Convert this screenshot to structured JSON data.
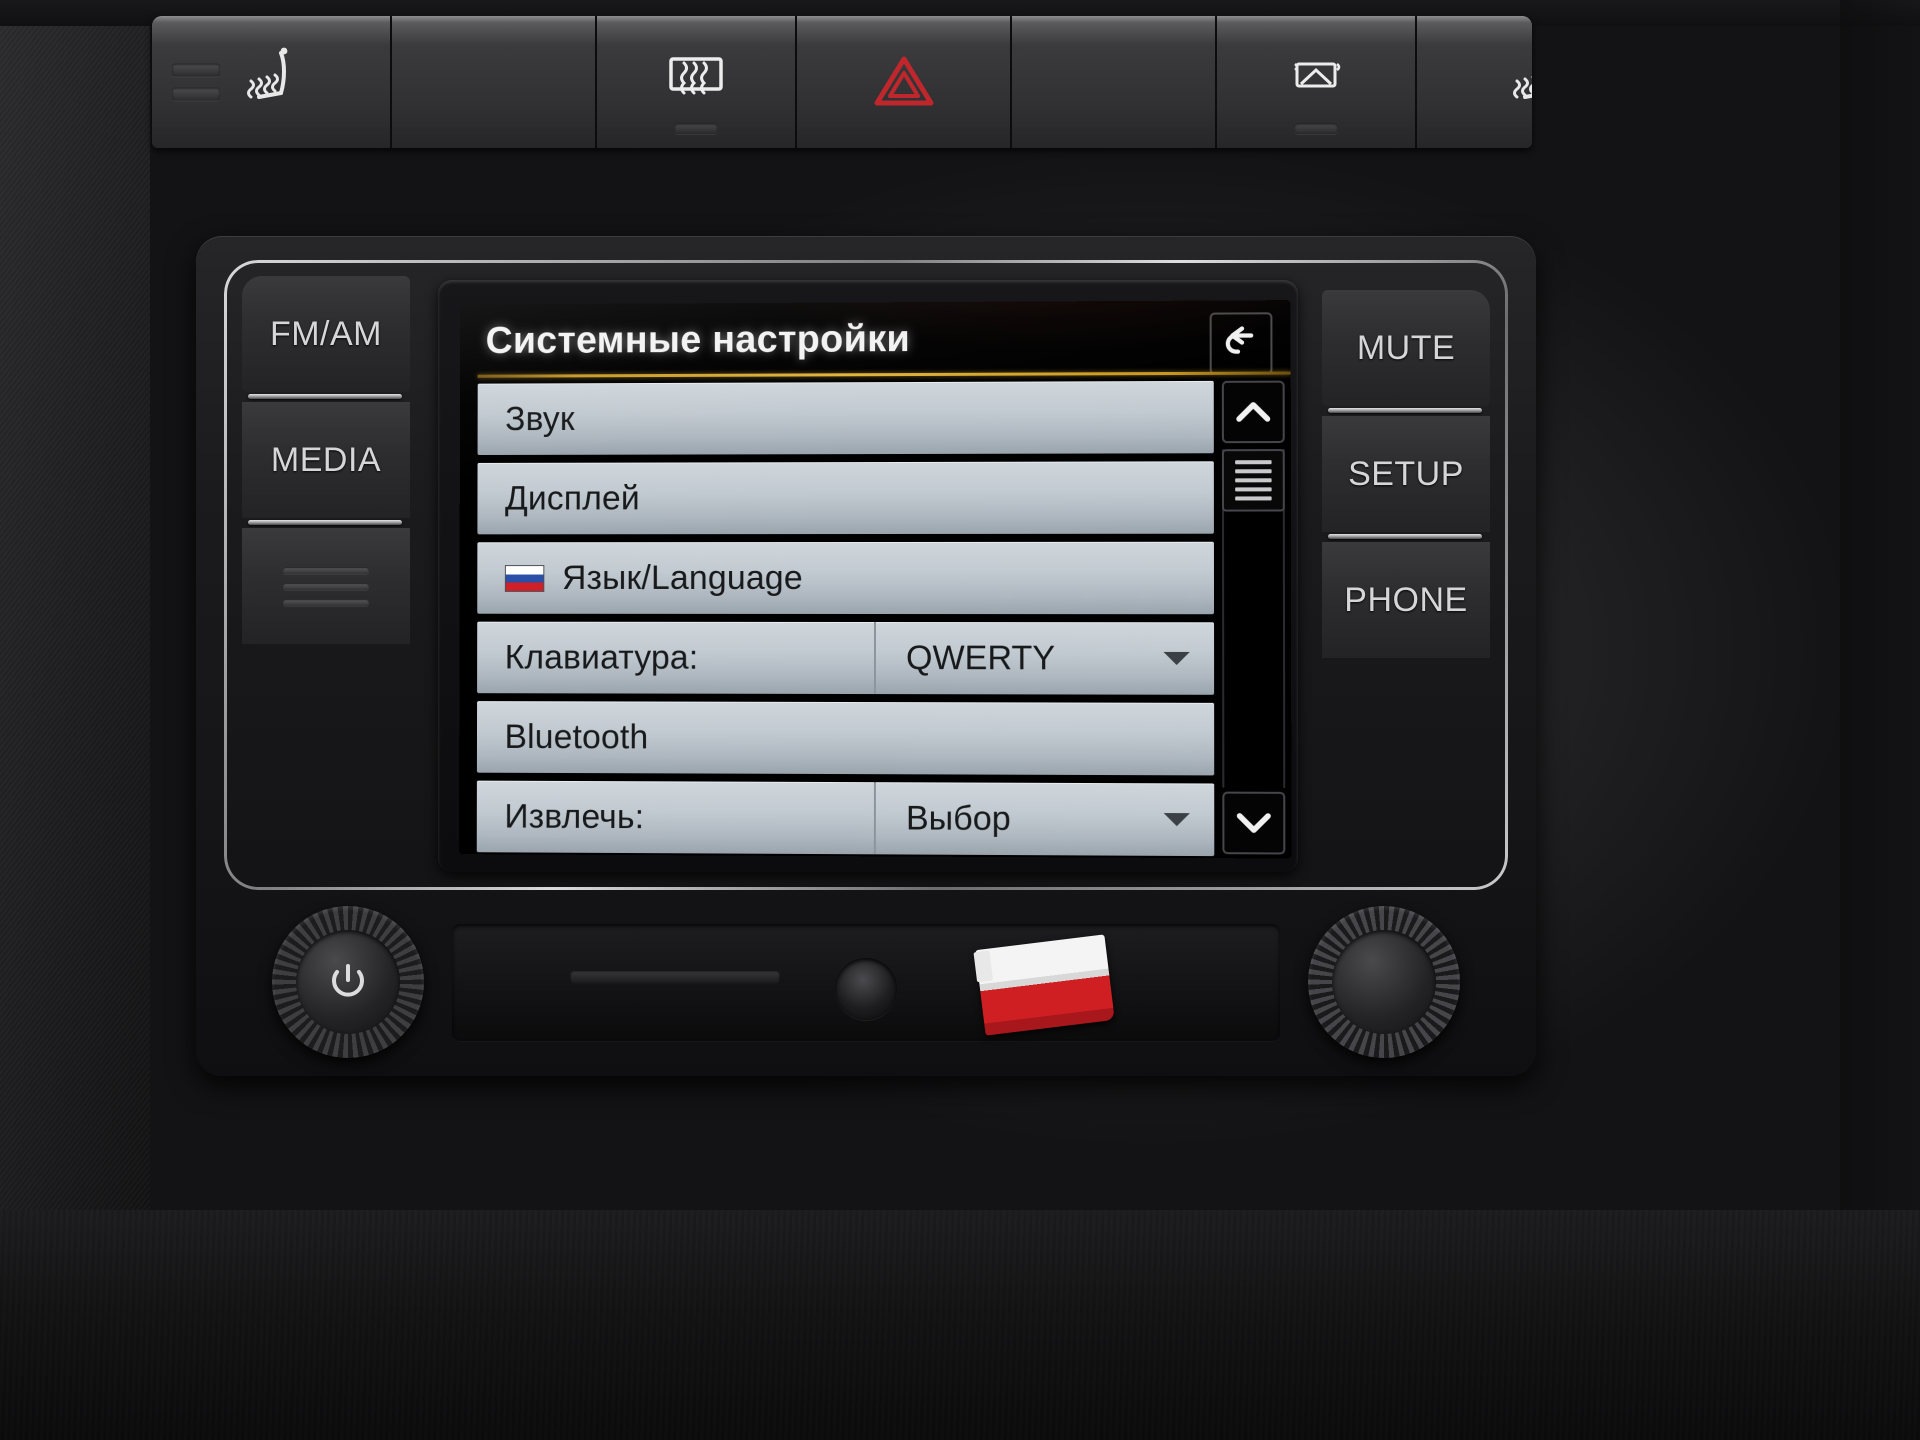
{
  "climate_strip": {
    "buttons": [
      {
        "name": "seat-heater-left",
        "icon": "heated-seat-icon",
        "has_led": false,
        "has_ribs": true
      },
      {
        "name": "climate-blank-1",
        "icon": "",
        "has_led": false,
        "has_ribs": false
      },
      {
        "name": "rear-window-defrost",
        "icon": "rear-defrost-icon",
        "has_led": true,
        "has_ribs": false
      },
      {
        "name": "hazard-warning",
        "icon": "hazard-triangle-icon",
        "has_led": false,
        "has_ribs": false
      },
      {
        "name": "climate-blank-2",
        "icon": "",
        "has_led": false,
        "has_ribs": false
      },
      {
        "name": "rear-wiper-washer",
        "icon": "rear-washer-icon",
        "has_led": true,
        "has_ribs": false
      },
      {
        "name": "seat-heater-right",
        "icon": "heated-seat-icon",
        "has_led": false,
        "has_ribs": true
      }
    ],
    "hazard_color": "#c0272d"
  },
  "head_unit": {
    "left_buttons": [
      {
        "label": "FM/AM",
        "name": "fm-am-button"
      },
      {
        "label": "MEDIA",
        "name": "media-button"
      },
      {
        "label": "",
        "name": "menu-button"
      }
    ],
    "right_buttons": [
      {
        "label": "MUTE",
        "name": "mute-button"
      },
      {
        "label": "SETUP",
        "name": "setup-button"
      },
      {
        "label": "PHONE",
        "name": "phone-button"
      }
    ],
    "power_knob": "power-volume-knob",
    "tune_knob": "tune-scroll-knob",
    "cd_slot": "cd-slot",
    "aux_jack": "aux-input-jack",
    "sd_card": "sd-card"
  },
  "screen": {
    "title": "Системные настройки",
    "back_button": "back-arrow-icon",
    "accent_color": "#d8ab33",
    "list": [
      {
        "label": "Звук",
        "value": "",
        "flag": false,
        "caret": false
      },
      {
        "label": "Дисплей",
        "value": "",
        "flag": false,
        "caret": false
      },
      {
        "label": "Язык/Language",
        "value": "",
        "flag": true,
        "caret": false
      },
      {
        "label": "Клавиатура:",
        "value": "QWERTY",
        "flag": false,
        "caret": true
      },
      {
        "label": "Bluetooth",
        "value": "",
        "flag": false,
        "caret": false
      },
      {
        "label": "Извлечь:",
        "value": "Выбор",
        "flag": false,
        "caret": true
      }
    ],
    "scrollbar": {
      "up": "chevron-up-icon",
      "thumb": "scrollbar-thumb",
      "down": "chevron-down-icon"
    }
  }
}
